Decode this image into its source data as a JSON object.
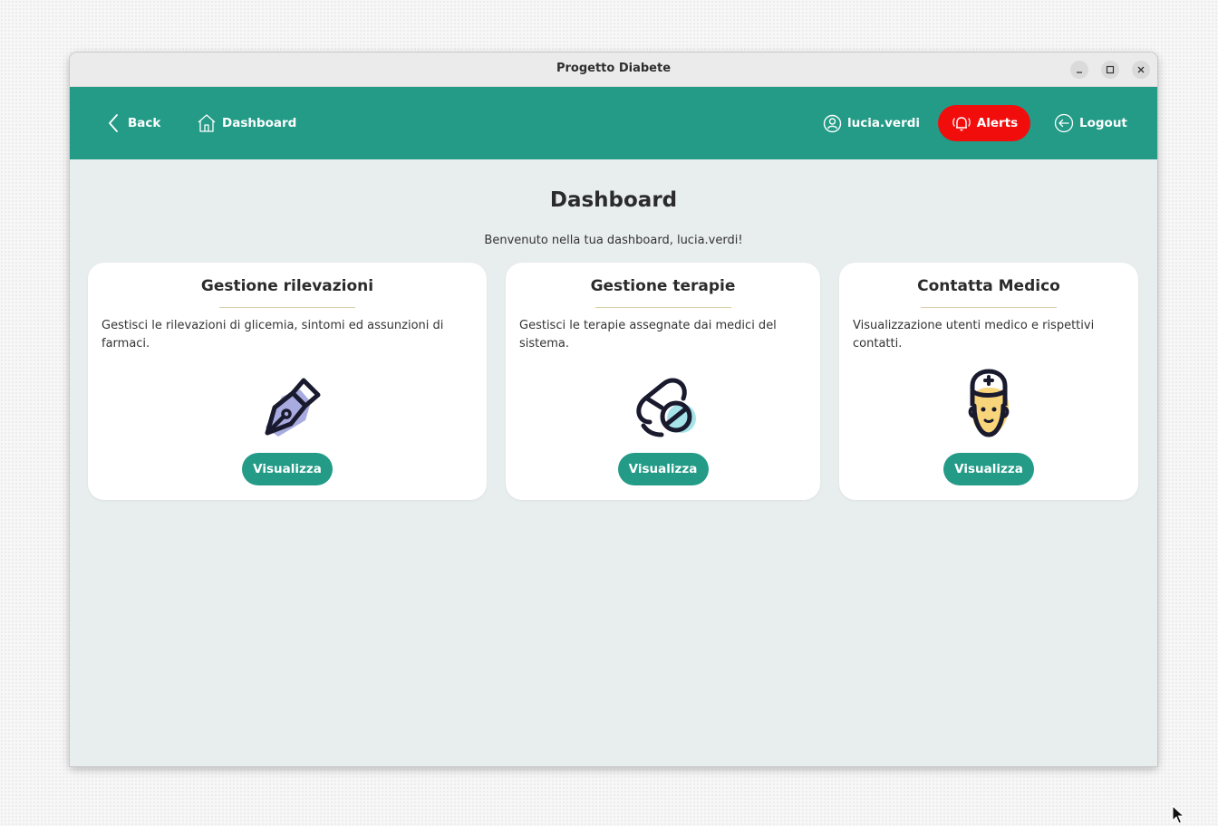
{
  "window": {
    "title": "Progetto Diabete"
  },
  "nav": {
    "back_label": "Back",
    "dashboard_label": "Dashboard",
    "user_label": "lucia.verdi",
    "alerts_label": "Alerts",
    "logout_label": "Logout"
  },
  "colors": {
    "accent": "#239b87",
    "alert": "#f20d0d",
    "background": "#e8eeed"
  },
  "page": {
    "title": "Dashboard",
    "welcome": "Benvenuto nella tua dashboard,  lucia.verdi!"
  },
  "cards": [
    {
      "title": "Gestione rilevazioni",
      "description": "Gestisci le rilevazioni di glicemia, sintomi ed assunzioni di farmaci.",
      "button": "Visualizza",
      "icon": "fountain-pen-icon"
    },
    {
      "title": "Gestione terapie",
      "description": "Gestisci le terapie assegnate dai medici del sistema.",
      "button": "Visualizza",
      "icon": "pill-icon"
    },
    {
      "title": "Contatta Medico",
      "description": "Visualizzazione utenti medico e rispettivi contatti.",
      "button": "Visualizza",
      "icon": "doctor-icon"
    }
  ]
}
